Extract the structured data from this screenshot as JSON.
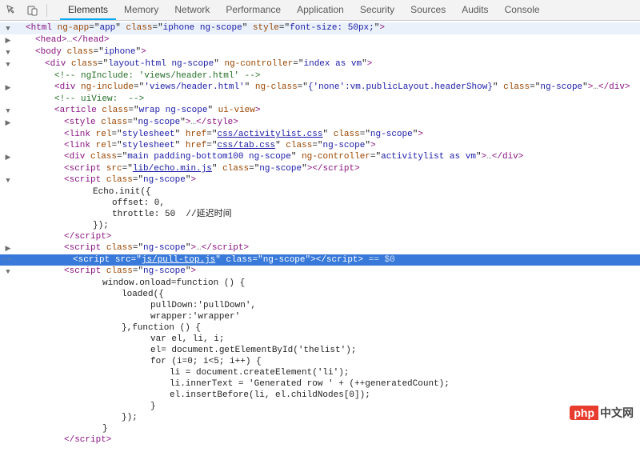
{
  "toolbar": {
    "tabs": [
      "Elements",
      "Memory",
      "Network",
      "Performance",
      "Application",
      "Security",
      "Sources",
      "Audits",
      "Console"
    ],
    "active_tab": "Elements"
  },
  "lines": [
    {
      "indent": 0,
      "arrow": "▼",
      "type": "tag",
      "open": "<",
      "name": "html",
      "attrs": [
        [
          "ng-app",
          "app"
        ],
        [
          "class",
          "iphone ng-scope"
        ],
        [
          "style",
          "font-size: 50px;"
        ]
      ],
      "close": ">",
      "hl": true
    },
    {
      "indent": 1,
      "arrow": "▶",
      "type": "tagpair",
      "open": "<",
      "name": "head",
      "close": ">",
      "ellip": true,
      "endname": "head"
    },
    {
      "indent": 1,
      "arrow": "▼",
      "type": "tag",
      "open": "<",
      "name": "body",
      "attrs": [
        [
          "class",
          "iphone"
        ]
      ],
      "close": ">"
    },
    {
      "indent": 2,
      "arrow": "▼",
      "type": "tag",
      "open": "<",
      "name": "div",
      "attrs": [
        [
          "class",
          "layout-html ng-scope"
        ],
        [
          "ng-controller",
          "index as vm"
        ]
      ],
      "close": ">"
    },
    {
      "indent": 3,
      "arrow": "",
      "type": "comment",
      "text": "<!-- ngInclude: 'views/header.html' -->"
    },
    {
      "indent": 3,
      "arrow": "▶",
      "type": "tagpair",
      "open": "<",
      "name": "div",
      "attrs": [
        [
          "ng-include",
          "'views/header.html'"
        ],
        [
          "ng-class",
          "{'none':vm.publicLayout.headerShow}"
        ],
        [
          "class",
          "ng-scope"
        ]
      ],
      "close": ">",
      "ellip": true,
      "endname": "div"
    },
    {
      "indent": 3,
      "arrow": "",
      "type": "comment",
      "text": "<!-- uiView:  -->"
    },
    {
      "indent": 3,
      "arrow": "▼",
      "type": "tag",
      "open": "<",
      "name": "article",
      "attrs": [
        [
          "class",
          "wrap ng-scope"
        ],
        [
          "ui-view",
          ""
        ]
      ],
      "close": ">"
    },
    {
      "indent": 4,
      "arrow": "▶",
      "type": "tagpair",
      "open": "<",
      "name": "style",
      "attrs": [
        [
          "class",
          "ng-scope"
        ]
      ],
      "close": ">",
      "ellip": true,
      "endname": "style"
    },
    {
      "indent": 4,
      "arrow": "",
      "type": "tag",
      "open": "<",
      "name": "link",
      "attrs": [
        [
          "rel",
          "stylesheet"
        ],
        [
          "href",
          "css/activitylist.css",
          "link"
        ],
        [
          "class",
          "ng-scope"
        ]
      ],
      "close": ">"
    },
    {
      "indent": 4,
      "arrow": "",
      "type": "tag",
      "open": "<",
      "name": "link",
      "attrs": [
        [
          "rel",
          "stylesheet"
        ],
        [
          "href",
          "css/tab.css",
          "link"
        ],
        [
          "class",
          "ng-scope"
        ]
      ],
      "close": ">"
    },
    {
      "indent": 4,
      "arrow": "▶",
      "type": "tagpair",
      "open": "<",
      "name": "div",
      "attrs": [
        [
          "class",
          "main padding-bottom100 ng-scope"
        ],
        [
          "ng-controller",
          "activitylist as vm"
        ]
      ],
      "close": ">",
      "ellip": true,
      "endname": "div"
    },
    {
      "indent": 4,
      "arrow": "",
      "type": "tagpair",
      "open": "<",
      "name": "script",
      "attrs": [
        [
          "src",
          "lib/echo.min.js",
          "link"
        ],
        [
          "class",
          "ng-scope"
        ]
      ],
      "close": ">",
      "endname": "script"
    },
    {
      "indent": 4,
      "arrow": "▼",
      "type": "tag",
      "open": "<",
      "name": "script",
      "attrs": [
        [
          "class",
          "ng-scope"
        ]
      ],
      "close": ">"
    },
    {
      "indent": 7,
      "arrow": "",
      "type": "text",
      "text": "Echo.init({"
    },
    {
      "indent": 9,
      "arrow": "",
      "type": "text",
      "text": "offset: 0,"
    },
    {
      "indent": 9,
      "arrow": "",
      "type": "text",
      "text": "throttle: 50  //延迟时间"
    },
    {
      "indent": 7,
      "arrow": "",
      "type": "text",
      "text": "});"
    },
    {
      "indent": 4,
      "arrow": "",
      "type": "endtag",
      "name": "script"
    },
    {
      "indent": 4,
      "arrow": "▶",
      "type": "tagpair",
      "open": "<",
      "name": "script",
      "attrs": [
        [
          "class",
          "ng-scope"
        ]
      ],
      "close": ">",
      "ellip": true,
      "endname": "script"
    },
    {
      "indent": 4,
      "arrow": "",
      "type": "tagpair",
      "open": "<",
      "name": "script",
      "attrs": [
        [
          "src",
          "js/pull-top.js",
          "link"
        ],
        [
          "class",
          "ng-scope"
        ]
      ],
      "close": ">",
      "endname": "script",
      "selected": true,
      "eq0": true,
      "bullets": true
    },
    {
      "indent": 4,
      "arrow": "▼",
      "type": "tag",
      "open": "<",
      "name": "script",
      "attrs": [
        [
          "class",
          "ng-scope"
        ]
      ],
      "close": ">"
    },
    {
      "indent": 8,
      "arrow": "",
      "type": "text",
      "text": "window.onload=function () {"
    },
    {
      "indent": 10,
      "arrow": "",
      "type": "text",
      "text": "loaded({"
    },
    {
      "indent": 13,
      "arrow": "",
      "type": "text",
      "text": "pullDown:'pullDown',"
    },
    {
      "indent": 13,
      "arrow": "",
      "type": "text",
      "text": "wrapper:'wrapper'"
    },
    {
      "indent": 10,
      "arrow": "",
      "type": "text",
      "text": "},function () {"
    },
    {
      "indent": 13,
      "arrow": "",
      "type": "text",
      "text": "var el, li, i;"
    },
    {
      "indent": 13,
      "arrow": "",
      "type": "text",
      "text": "el= document.getElementById('thelist');"
    },
    {
      "indent": 13,
      "arrow": "",
      "type": "text",
      "text": "for (i=0; i<5; i++) {"
    },
    {
      "indent": 15,
      "arrow": "",
      "type": "text",
      "text": "li = document.createElement('li');"
    },
    {
      "indent": 15,
      "arrow": "",
      "type": "text",
      "text": "li.innerText = 'Generated row ' + (++generatedCount);"
    },
    {
      "indent": 15,
      "arrow": "",
      "type": "text",
      "text": "el.insertBefore(li, el.childNodes[0]);"
    },
    {
      "indent": 13,
      "arrow": "",
      "type": "text",
      "text": "}"
    },
    {
      "indent": 10,
      "arrow": "",
      "type": "text",
      "text": "});"
    },
    {
      "indent": 8,
      "arrow": "",
      "type": "text",
      "text": "}"
    },
    {
      "indent": 4,
      "arrow": "",
      "type": "endtag",
      "name": "script"
    }
  ],
  "watermark": {
    "left": "php",
    "right": "中文网"
  }
}
